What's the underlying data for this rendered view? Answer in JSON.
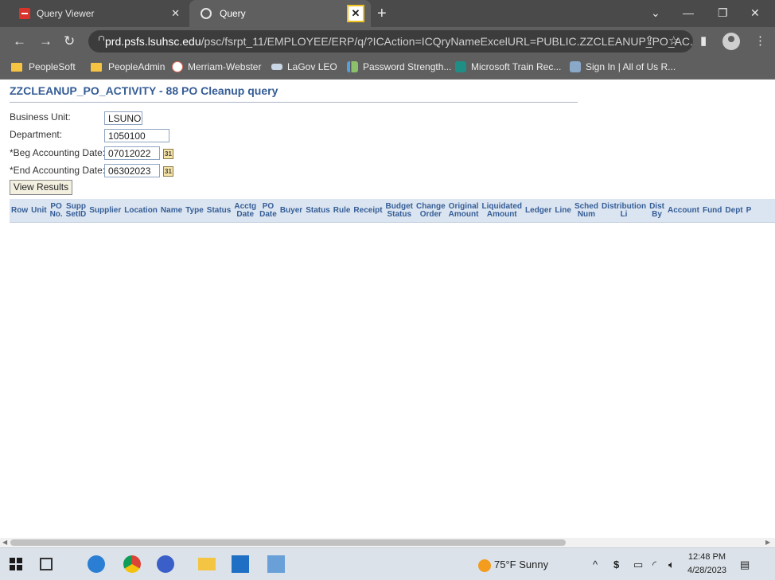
{
  "browser": {
    "tabs": [
      {
        "title": "Query Viewer",
        "active": false
      },
      {
        "title": "Query",
        "active": true
      }
    ],
    "url_host": "prd.psfs.lsuhsc.edu",
    "url_path": "/psc/fsrpt_11/EMPLOYEE/ERP/q/?ICAction=ICQryNameExcelURL=PUBLIC.ZZCLEANUP_PO_AC...",
    "bookmarks": [
      {
        "label": "PeopleSoft",
        "icon": "folder-icon"
      },
      {
        "label": "PeopleAdmin",
        "icon": "folder-icon"
      },
      {
        "label": "Merriam-Webster",
        "icon": "merriam-webster-icon"
      },
      {
        "label": "LaGov LEO",
        "icon": "sap-icon"
      },
      {
        "label": "Password Strength...",
        "icon": "password-strength-icon"
      },
      {
        "label": "Microsoft Train Rec...",
        "icon": "sharepoint-icon"
      },
      {
        "label": "Sign In | All of Us R...",
        "icon": "all-of-us-icon"
      }
    ]
  },
  "page": {
    "title": "ZZCLEANUP_PO_ACTIVITY - 88 PO Cleanup query",
    "prompts": {
      "business_unit_label": "Business Unit:",
      "business_unit_value": "LSUNO",
      "department_label": "Department:",
      "department_value": "1050100",
      "beg_date_label": "*Beg Accounting Date:",
      "beg_date_value": "07012022",
      "end_date_label": "*End Accounting Date:",
      "end_date_value": "06302023",
      "calendar_icon_text": "31"
    },
    "view_results_label": "View Results",
    "columns": [
      [
        "Row"
      ],
      [
        "Unit"
      ],
      [
        "PO",
        "No."
      ],
      [
        "Supp",
        "SetID"
      ],
      [
        "Supplier"
      ],
      [
        "Location"
      ],
      [
        "Name"
      ],
      [
        "Type"
      ],
      [
        "Status"
      ],
      [
        "Acctg",
        "Date"
      ],
      [
        "PO",
        "Date"
      ],
      [
        "Buyer"
      ],
      [
        "Status"
      ],
      [
        "Rule"
      ],
      [
        "Receipt"
      ],
      [
        "Budget",
        "Status"
      ],
      [
        "Change",
        "Order"
      ],
      [
        "Original",
        "Amount"
      ],
      [
        "Liquidated",
        "Amount"
      ],
      [
        "Ledger"
      ],
      [
        "Line"
      ],
      [
        "Sched",
        "Num"
      ],
      [
        "Distribution",
        "Li"
      ],
      [
        "Dist",
        "By"
      ],
      [
        "Account"
      ],
      [
        "Fund"
      ],
      [
        "Dept"
      ],
      [
        "P"
      ]
    ]
  },
  "taskbar": {
    "weather": "75°F  Sunny",
    "time": "12:48 PM",
    "date": "4/28/2023"
  },
  "colors": {
    "title_blue": "#355d96",
    "header_bg": "#dbe5f1",
    "highlight": "#f2c21c"
  }
}
